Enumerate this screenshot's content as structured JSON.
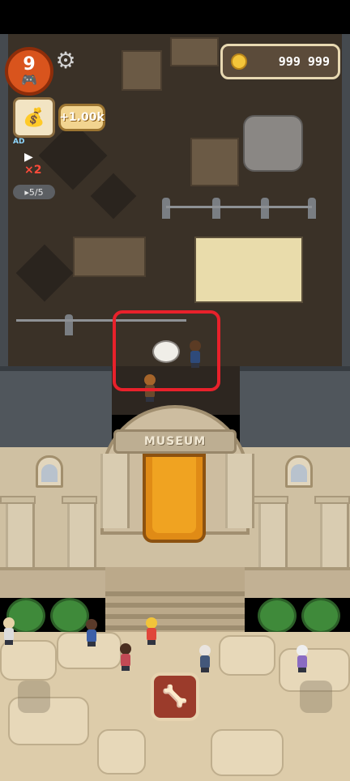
{
  "hud": {
    "level": "9",
    "gamepad_icon": "gamepad-icon",
    "settings_icon": "gear-icon",
    "money": "999 999",
    "coin_icon": "coin-icon",
    "bonus": "+1.00k",
    "ad_label": "AD",
    "video_icon": "video-play-icon",
    "multiplier": "×2",
    "charges": "▸5/5"
  },
  "museum": {
    "sign": "MUSEUM"
  },
  "actions": {
    "fossil_button_icon": "fossil-bone-icon"
  },
  "colors": {
    "highlight": "#e8212b",
    "carpet": "#f0a321",
    "level_badge": "#d9541d"
  }
}
